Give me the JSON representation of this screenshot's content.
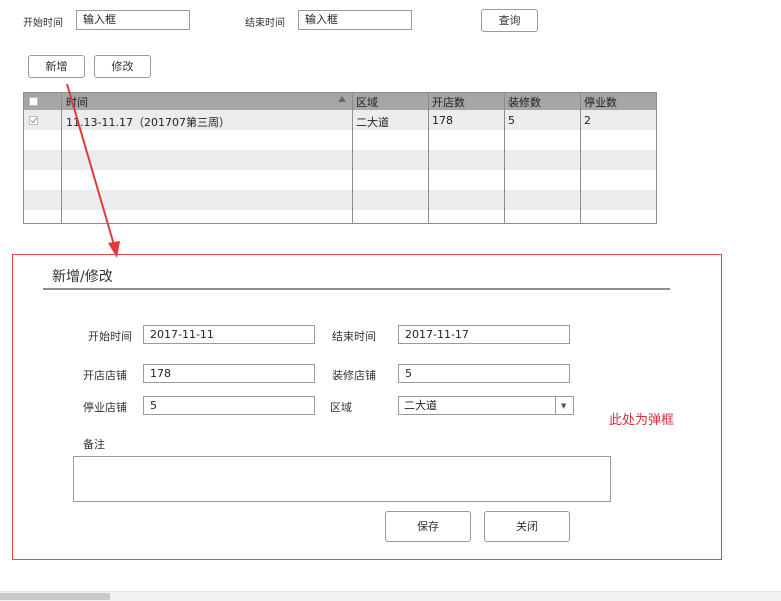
{
  "filters": {
    "start_label": "开始时间",
    "start_value": "输入框",
    "end_label": "结束时间",
    "end_value": "输入框",
    "query_label": "查询"
  },
  "actions": {
    "add_label": "新增",
    "edit_label": "修改"
  },
  "table": {
    "columns": [
      "时间",
      "区域",
      "开店数",
      "装修数",
      "停业数"
    ],
    "rows": [
      {
        "time": "11.13-11.17（201707第三周）",
        "area": "二大道",
        "open": "178",
        "renovate": "5",
        "closed": "2"
      }
    ]
  },
  "modal": {
    "title": "新增/修改",
    "start_label": "开始时间",
    "start_value": "2017-11-11",
    "end_label": "结束时间",
    "end_value": "2017-11-17",
    "open_label": "开店店铺",
    "open_value": "178",
    "renovate_label": "装修店铺",
    "renovate_value": "5",
    "closed_label": "停业店铺",
    "closed_value": "5",
    "area_label": "区域",
    "area_value": "二大道",
    "note_label": "备注",
    "note_value": "",
    "save_label": "保存",
    "close_label": "关闭"
  },
  "annotation": {
    "text": "此处为弹框",
    "color": "#d2333c",
    "arrow_color": "#e03a3a"
  },
  "icons": {
    "sort": "sort-up-icon",
    "dropdown": "dropdown-arrow-icon",
    "checkbox": "checkbox-icon"
  }
}
